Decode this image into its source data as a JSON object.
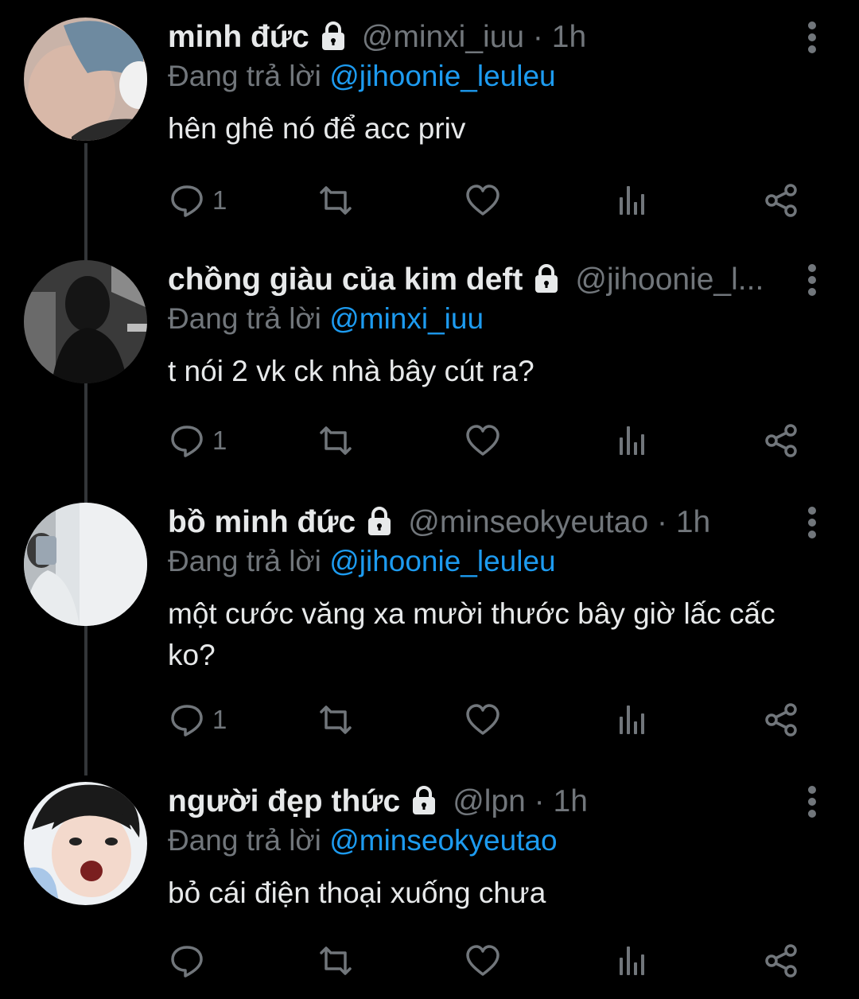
{
  "reply_prefix": "Đang trả lời",
  "tweets": [
    {
      "name": "minh đức",
      "handle": "@minxi_iuu",
      "time": "1h",
      "replying_to": "@jihoonie_leuleu",
      "text": "hên ghê nó để acc priv",
      "reply_count": "1"
    },
    {
      "name": "chồng giàu của kim deft",
      "handle": "@jihoonie_l...",
      "time": "",
      "replying_to": "@minxi_iuu",
      "text": "t nói 2 vk ck nhà bây cút ra?",
      "reply_count": "1"
    },
    {
      "name": "bồ minh đức",
      "handle": "@minseokyeutao",
      "time": "1h",
      "replying_to": "@jihoonie_leuleu",
      "text": "một cước văng xa mười thước bây giờ lấc cấc ko?",
      "reply_count": "1"
    },
    {
      "name": "người đẹp thức",
      "handle": "@lpn",
      "time": "1h",
      "replying_to": "@minseokyeutao",
      "text": "bỏ cái điện thoại xuống chưa",
      "reply_count": ""
    }
  ],
  "colors": {
    "background": "#000000",
    "primary_text": "#e7e9ea",
    "secondary_text": "#71767b",
    "link": "#1d9bf0",
    "thread_line": "#333639"
  },
  "icons": [
    "lock-icon",
    "more-icon",
    "reply-icon",
    "retweet-icon",
    "like-icon",
    "analytics-icon",
    "share-icon"
  ]
}
